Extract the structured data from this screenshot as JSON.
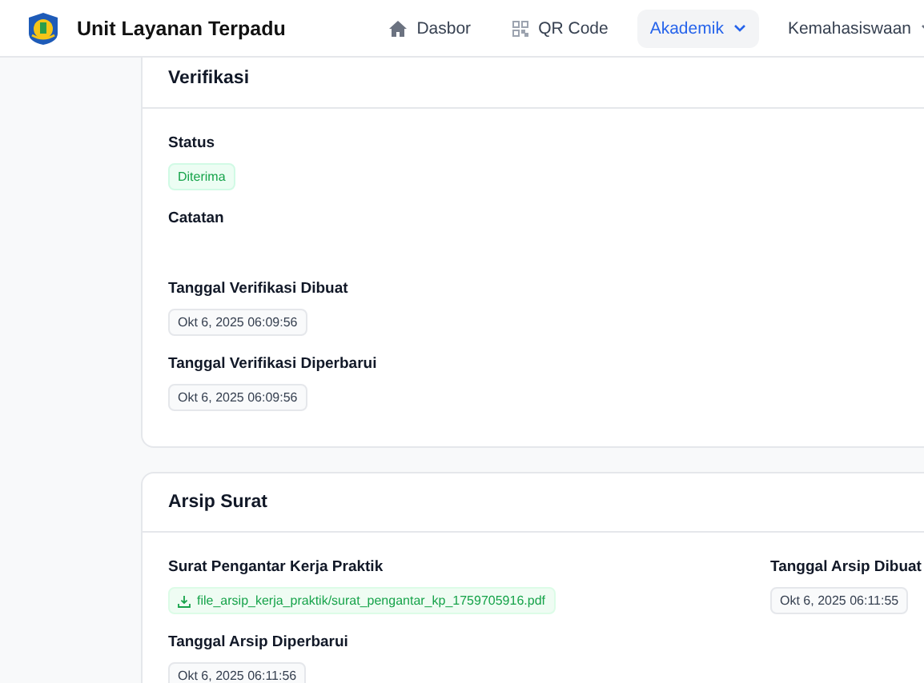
{
  "header": {
    "app_title": "Unit Layanan Terpadu",
    "nav": [
      {
        "label": "Dasbor",
        "kind": "home",
        "selected": false,
        "dropdown": false
      },
      {
        "label": "QR Code",
        "kind": "qr",
        "selected": false,
        "dropdown": false
      },
      {
        "label": "Akademik",
        "kind": "plain",
        "selected": true,
        "dropdown": true
      },
      {
        "label": "Kemahasiswaan",
        "kind": "plain",
        "selected": false,
        "dropdown": true
      }
    ]
  },
  "cards": [
    {
      "title": "Verifikasi",
      "fields": [
        {
          "label": "Status",
          "kind": "badge",
          "value": "Diterima"
        },
        {
          "label": "Catatan",
          "kind": "empty"
        },
        {
          "label": "Tanggal Verifikasi Dibuat",
          "kind": "date",
          "value": "Okt 6, 2025 06:09:56"
        },
        {
          "label": "Tanggal Verifikasi Diperbarui",
          "kind": "date",
          "value": "Okt 6, 2025 06:09:56"
        }
      ]
    },
    {
      "title": "Arsip Surat",
      "fields": [
        {
          "label": "Surat Pengantar Kerja Praktik",
          "kind": "file",
          "value": "file_arsip_kerja_praktik/surat_pengantar_kp_1759705916.pdf"
        },
        {
          "label": "Tanggal Arsip Dibuat",
          "kind": "date",
          "value": "Okt 6, 2025 06:11:55"
        },
        {
          "label": "Tanggal Arsip Diperbarui",
          "kind": "date",
          "value": "Okt 6, 2025 06:11:56"
        }
      ]
    }
  ]
}
